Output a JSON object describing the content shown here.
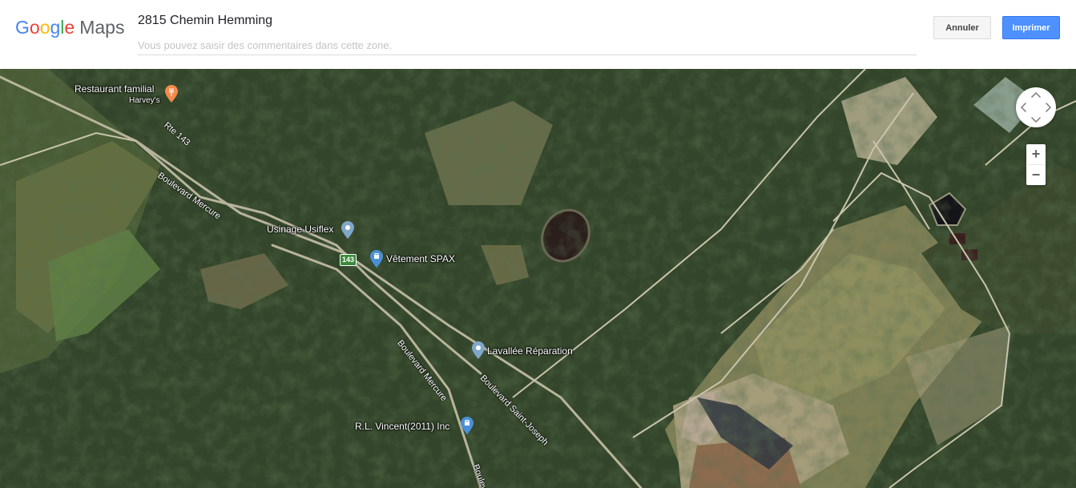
{
  "header": {
    "logo": {
      "google": [
        "G",
        "o",
        "o",
        "g",
        "l",
        "e"
      ],
      "maps": "Maps"
    },
    "title": "2815 Chemin Hemming",
    "comment_placeholder": "Vous pouvez saisir des commentaires dans cette zone.",
    "cancel_label": "Annuler",
    "print_label": "Imprimer"
  },
  "map": {
    "places": [
      {
        "name": "Restaurant familial",
        "sub": "Harvey's"
      },
      {
        "name": "Usinage Usiflex"
      },
      {
        "name": "Vêtement SPAX"
      },
      {
        "name": "Lavallée Réparation"
      },
      {
        "name": "R.L. Vincent(2011) Inc"
      }
    ],
    "roads": {
      "rte143": "Rte 143",
      "mercure1": "Boulevard Mercure",
      "mercure2": "Boulevard Mercure",
      "mercure3": "Boulevard",
      "saint_joseph": "Boulevard Saint-Joseph"
    },
    "route_shield": "143",
    "controls": {
      "zoom_in": "+",
      "zoom_out": "−"
    },
    "colors": {
      "forest": "#2d3d22",
      "clearing": "#8d8a5e",
      "pin_blue": "#4a90d9",
      "pin_orange": "#f58a4b",
      "shield": "#3c8a3a"
    }
  }
}
